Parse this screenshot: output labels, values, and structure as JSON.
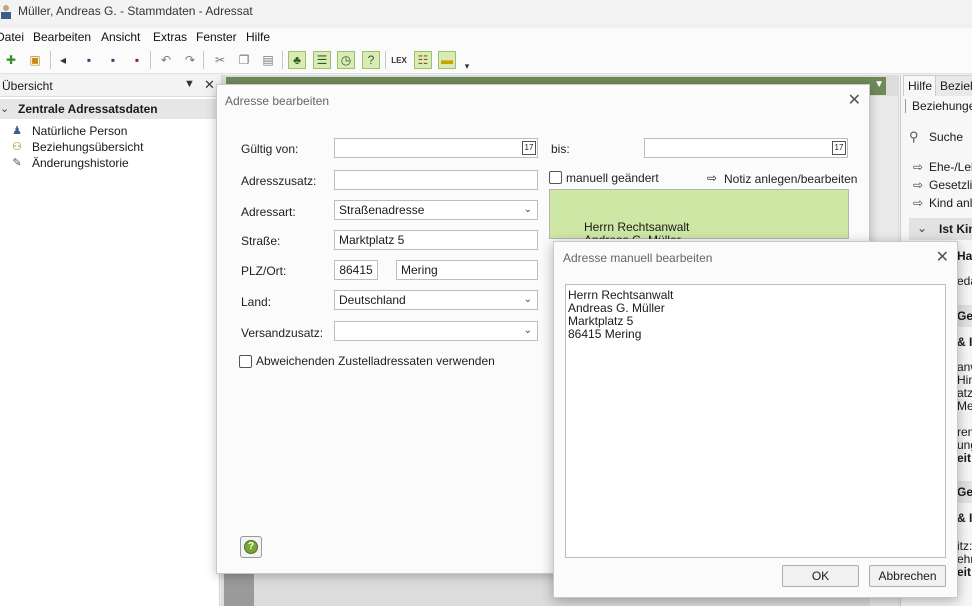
{
  "window": {
    "title": "Müller, Andreas G. - Stammdaten - Adressat"
  },
  "menu": [
    "Datei",
    "Bearbeiten",
    "Ansicht",
    "Extras",
    "Fenster",
    "Hilfe"
  ],
  "left_panel": {
    "title": "Übersicht",
    "group": "Zentrale Adressatsdaten",
    "items": [
      {
        "label": "Natürliche Person",
        "icon": "person-icon"
      },
      {
        "label": "Beziehungsübersicht",
        "icon": "relations-icon"
      },
      {
        "label": "Änderungshistorie",
        "icon": "history-icon"
      }
    ]
  },
  "right_panel": {
    "tabs": [
      "Hilfe",
      "Beziehu"
    ],
    "header": "Beziehungen",
    "search": "Suche",
    "links": [
      "Ehe-/Leb",
      "Gesetzlic",
      "Kind anle"
    ],
    "section": "Ist Kin",
    "fragments": [
      "Ha",
      "edat",
      "Ge",
      "& I",
      "anw",
      "Hin",
      "atz",
      "Mer",
      "renn",
      "ung",
      "eit:",
      "Ge",
      "& I",
      "itz:",
      "ehm",
      "eit:"
    ]
  },
  "dialog": {
    "title": "Adresse bearbeiten",
    "labels": {
      "gueltig_von": "Gültig von:",
      "bis": "bis:",
      "adresszusatz": "Adresszusatz:",
      "adressart": "Adressart:",
      "strasse": "Straße:",
      "plz_ort": "PLZ/Ort:",
      "land": "Land:",
      "versandzusatz": "Versandzusatz:"
    },
    "values": {
      "gueltig_von": "",
      "bis": "",
      "adresszusatz": "",
      "adressart": "Straßenadresse",
      "strasse": "Marktplatz 5",
      "plz": "86415",
      "ort": "Mering",
      "land": "Deutschland",
      "versandzusatz": ""
    },
    "calendar_icon_text": "17",
    "manuell_geaendert": "manuell geändert",
    "notiz_link": "Notiz anlegen/bearbeiten",
    "abweichend": "Abweichenden Zustelladressaten verwenden",
    "preview_lines": [
      "Herrn Rechtsanwalt",
      "Andreas G. Müller"
    ]
  },
  "dialog2": {
    "title": "Adresse manuell bearbeiten",
    "lines": [
      "Herrn Rechtsanwalt",
      "Andreas G. Müller",
      "Marktplatz 5",
      "86415 Mering"
    ],
    "ok": "OK",
    "cancel": "Abbrechen"
  }
}
